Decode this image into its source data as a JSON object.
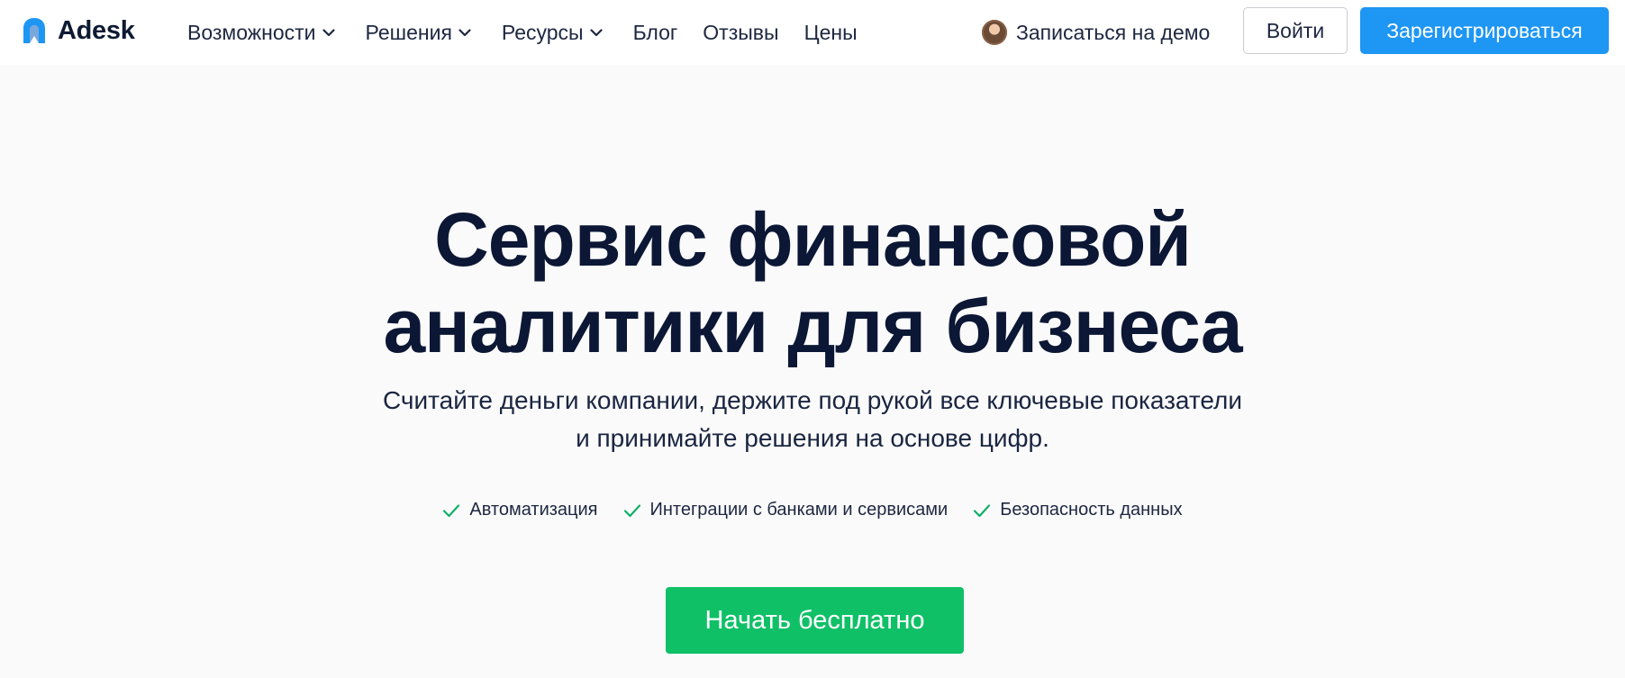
{
  "brand": {
    "name": "Adesk",
    "accent_color": "#1e96f3",
    "logo_icon": "adesk-logo-icon"
  },
  "nav": {
    "items": [
      {
        "label": "Возможности",
        "has_dropdown": true
      },
      {
        "label": "Решения",
        "has_dropdown": true
      },
      {
        "label": "Ресурсы",
        "has_dropdown": true
      },
      {
        "label": "Блог",
        "has_dropdown": false
      },
      {
        "label": "Отзывы",
        "has_dropdown": false
      },
      {
        "label": "Цены",
        "has_dropdown": false
      }
    ],
    "dropdown_icon": "chevron-down-icon"
  },
  "header_actions": {
    "demo_label": "Записаться на демо",
    "login_label": "Войти",
    "register_label": "Зарегистрироваться",
    "register_color": "#1e96f3"
  },
  "hero": {
    "title_line1": "Сервис финансовой",
    "title_line2": "аналитики для бизнеса",
    "subtitle_line1": "Считайте деньги компании, держите под рукой все ключевые показатели",
    "subtitle_line2": "и принимайте решения на основе цифр.",
    "features": [
      "Автоматизация",
      "Интеграции с банками и сервисами",
      "Безопасность данных"
    ],
    "feature_icon": "check-icon",
    "feature_icon_color": "#0fb066",
    "cta_label": "Начать бесплатно",
    "cta_color": "#0fc067"
  }
}
